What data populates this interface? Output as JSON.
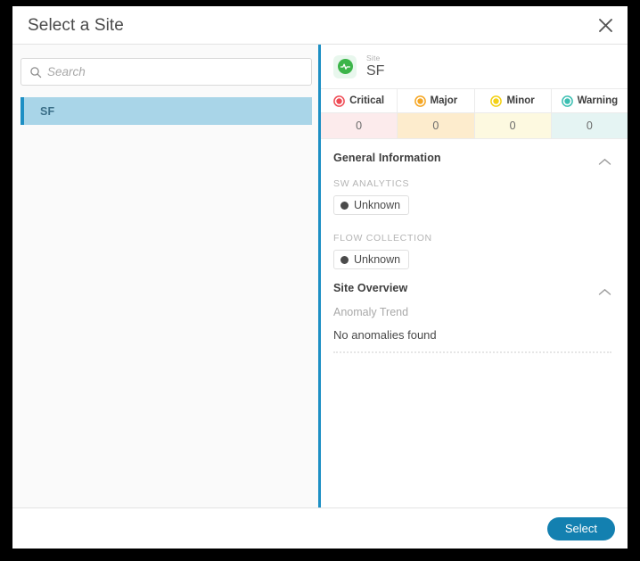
{
  "dialog": {
    "title": "Select a Site",
    "close_icon": "close-icon"
  },
  "sidebar": {
    "search": {
      "icon": "search-icon",
      "value": "",
      "placeholder": "Search"
    },
    "items": [
      {
        "label": "SF",
        "selected": true
      }
    ]
  },
  "detail": {
    "header": {
      "icon": "site-health-icon",
      "label": "Site",
      "name": "SF"
    },
    "severity": [
      {
        "label": "Critical",
        "value": "0",
        "icon": "critical-icon",
        "color": "#ef4b55",
        "bg": "#fcebec"
      },
      {
        "label": "Major",
        "value": "0",
        "icon": "major-icon",
        "color": "#f5a623",
        "bg": "#fdeccd"
      },
      {
        "label": "Minor",
        "value": "0",
        "icon": "minor-icon",
        "color": "#f3d117",
        "bg": "#fdf9e0"
      },
      {
        "label": "Warning",
        "value": "0",
        "icon": "warning-icon",
        "color": "#3bbfb2",
        "bg": "#e5f4f3"
      }
    ],
    "general_information": {
      "title": "General Information",
      "collapse_icon": "chevron-up-icon",
      "fields": [
        {
          "label": "SW ANALYTICS",
          "value": "Unknown",
          "status_color": "#4b4b4b"
        },
        {
          "label": "FLOW COLLECTION",
          "value": "Unknown",
          "status_color": "#4b4b4b"
        }
      ]
    },
    "site_overview": {
      "title": "Site Overview",
      "collapse_icon": "chevron-up-icon",
      "anomaly_label": "Anomaly Trend",
      "anomaly_value": "No anomalies found"
    }
  },
  "footer": {
    "select_label": "Select"
  },
  "colors": {
    "accent": "#1380b0",
    "divider_blue": "#1d8fc4",
    "selected_row": "#a9d5e8"
  }
}
